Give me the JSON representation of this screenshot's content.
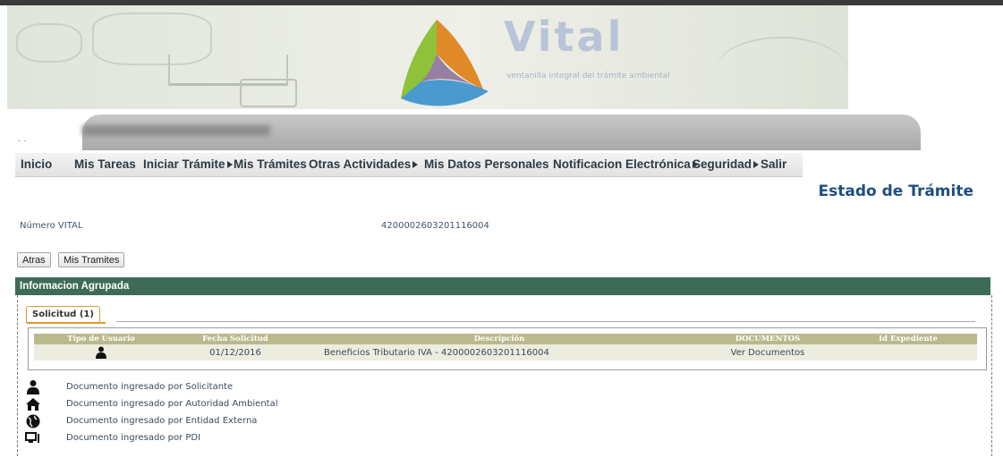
{
  "banner": {
    "logo_word": "Vital",
    "logo_tagline": "ventanilla integral del trámite ambiental"
  },
  "menu": {
    "items": [
      {
        "label": "Inicio",
        "has_submenu": false
      },
      {
        "label": "Mis Tareas",
        "has_submenu": false
      },
      {
        "label": "Iniciar Trámite",
        "has_submenu": true
      },
      {
        "label": "Mis Trámites",
        "has_submenu": false
      },
      {
        "label": "Otras Actividades",
        "has_submenu": true
      },
      {
        "label": "Mis Datos Personales",
        "has_submenu": false
      },
      {
        "label": "Notificacion Electrónica",
        "has_submenu": true
      },
      {
        "label": "Seguridad",
        "has_submenu": true
      },
      {
        "label": "Salir",
        "has_submenu": false
      }
    ]
  },
  "page": {
    "title": "Estado de Trámite",
    "numero_vital_label": "Número VITAL",
    "numero_vital_value": "4200002603201116004"
  },
  "buttons": {
    "back": "Atras",
    "my_procedures": "Mis Tramites"
  },
  "section": {
    "title": "Informacion Agrupada",
    "tab_label": "Solicitud (1)"
  },
  "table": {
    "columns": [
      "Tipo de Usuario",
      "Fecha Solicitud",
      "Descripción",
      "DOCUMENTOS",
      "Id Expediente"
    ],
    "rows": [
      {
        "user_type_icon": "person-icon",
        "date": "01/12/2016",
        "description": "Beneficios Tributario IVA - 4200002603201116004",
        "documents": "Ver Documentos",
        "file_id": ""
      }
    ]
  },
  "legend": [
    {
      "icon": "person-icon",
      "text": "Documento ingresado por Solicitante"
    },
    {
      "icon": "house-icon",
      "text": "Documento ingresado por Autoridad Ambiental"
    },
    {
      "icon": "globe-icon",
      "text": "Documento ingresado por Entidad Externa"
    },
    {
      "icon": "computer-icon",
      "text": "Documento ingresado por PDI"
    }
  ],
  "colors": {
    "section_header": "#3e6b58",
    "table_header": "#b9b98d",
    "title": "#1f4e82",
    "tab_accent": "#e09a2a"
  }
}
